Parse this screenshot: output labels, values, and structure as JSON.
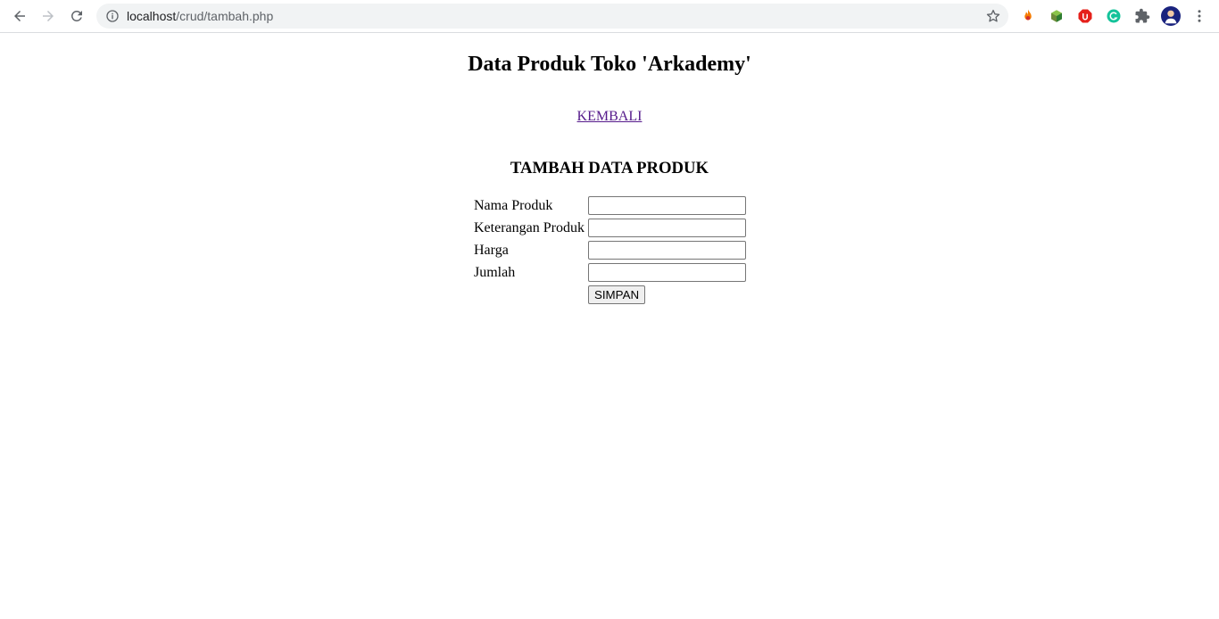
{
  "browser": {
    "url_host": "localhost",
    "url_path": "/crud/tambah.php",
    "extensions": [
      "fire-extension-icon",
      "cube-extension-icon",
      "adblock-icon",
      "grammarly-icon",
      "puzzle-extensions-icon",
      "profile-avatar",
      "kebab-menu-icon"
    ]
  },
  "page": {
    "title": "Data Produk Toko 'Arkademy'",
    "back_link": "KEMBALI",
    "form_title": "TAMBAH DATA PRODUK",
    "fields": [
      {
        "label": "Nama Produk",
        "value": ""
      },
      {
        "label": "Keterangan Produk",
        "value": ""
      },
      {
        "label": "Harga",
        "value": ""
      },
      {
        "label": "Jumlah",
        "value": ""
      }
    ],
    "submit_label": "SIMPAN"
  },
  "colors": {
    "link_visited": "#551a8b",
    "adblock_red": "#e5201b",
    "grammarly_green": "#15c39a",
    "avatar_blue": "#1a237e"
  }
}
